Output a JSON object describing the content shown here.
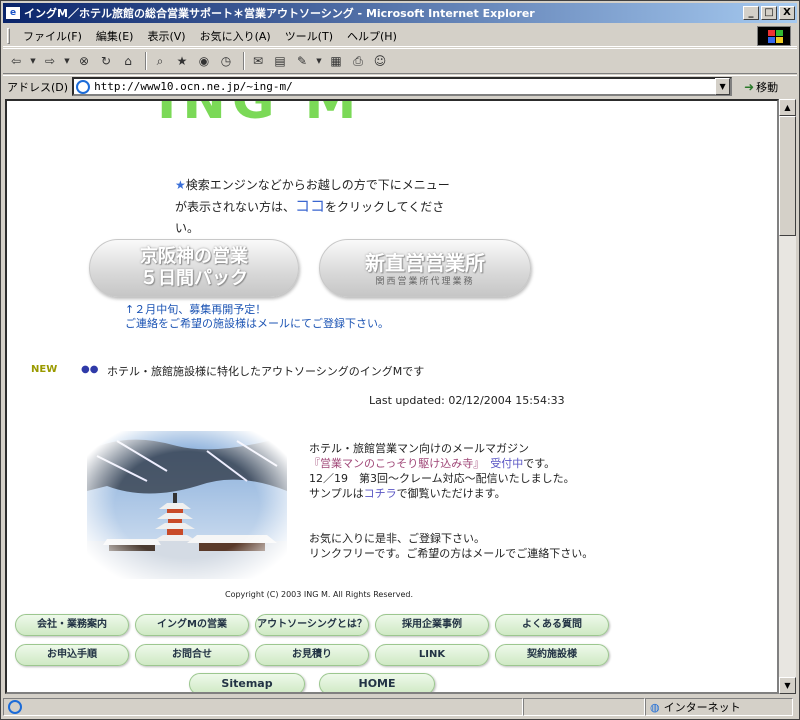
{
  "window": {
    "title": "イングM／ホテル旅館の総合営業サポート＊営業アウトソーシング - Microsoft Internet Explorer",
    "min": "_",
    "max": "□",
    "close": "X"
  },
  "menu": [
    "ファイル(F)",
    "編集(E)",
    "表示(V)",
    "お気に入り(A)",
    "ツール(T)",
    "ヘルプ(H)"
  ],
  "address": {
    "label": "アドレス(D)",
    "url": "http://www10.ocn.ne.jp/~ing-m/",
    "go": "移動"
  },
  "page": {
    "logo_text": "ING M",
    "note": {
      "star": "★",
      "line1": "検索エンジンなどからお越しの方で下にメニュー",
      "line2a": "が表示されない方は、",
      "koko": "ココ",
      "line2b": "をクリックしてくださ",
      "line3": "い。"
    },
    "banner_left": {
      "l1": "京阪神の営業",
      "l2": "５日間パック"
    },
    "banner_right": {
      "l1": "新直営営業所",
      "sub": "関西営業所代理業務"
    },
    "link_lines": [
      "↑２月中旬、募集再開予定！",
      "ご連絡をご希望の施設様はメールにてご登録下さい。"
    ],
    "new_badge": "NEW",
    "dots": "●●",
    "new_text": "ホテル・旅館施設様に特化したアウトソーシングのイングMです",
    "updated": "Last updated: 02/12/2004 15:54:33",
    "mag": {
      "line1": "ホテル・旅館営業マン向けのメールマガジン",
      "line2a": "『営業マンのこっそり駆け込み寺』",
      "line2b": "受付中",
      "line2c": "です。",
      "line3": "12／19　第3回〜クレーム対応〜配信いたしました。",
      "line4a": "サンプルは",
      "line4b": "コチラ",
      "line4c": "で御覧いただけます。"
    },
    "fav": [
      "お気に入りに是非、ご登録下さい。",
      "リンクフリーです。ご希望の方はメールでご連絡下さい。"
    ],
    "copyright": "Copyright (C) 2003 ING M. All Rights Reserved."
  },
  "nav_row1": [
    "会社・業務案内",
    "イングMの営業",
    "アウトソーシングとは？",
    "採用企業事例",
    "よくある質問"
  ],
  "nav_row2": [
    "お申込手順",
    "お問合せ",
    "お見積り",
    "LINK",
    "契約施設様"
  ],
  "nav_row3": [
    "Sitemap",
    "HOME"
  ],
  "status": {
    "zone": "インターネット"
  }
}
